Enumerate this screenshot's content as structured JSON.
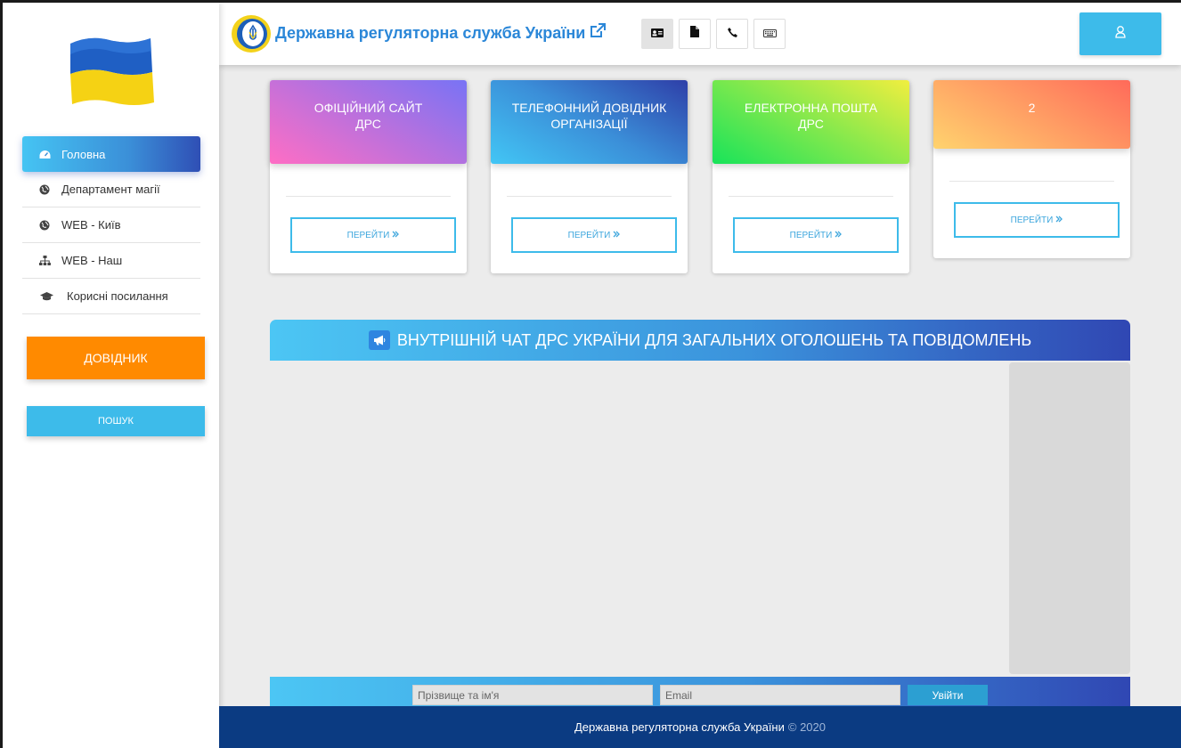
{
  "header": {
    "title": "Державна регуляторна служба України",
    "tool_buttons": [
      {
        "icon": "id-card-icon"
      },
      {
        "icon": "file-icon"
      },
      {
        "icon": "phone-icon"
      },
      {
        "icon": "keyboard-icon"
      }
    ],
    "user_icon": "user-icon"
  },
  "sidebar": {
    "items": [
      {
        "label": "Головна",
        "icon": "dashboard-icon",
        "active": true
      },
      {
        "label": "Департамент магії",
        "icon": "globe-icon"
      },
      {
        "label": "WEB - Київ",
        "icon": "globe-icon"
      },
      {
        "label": "WEB - Наш",
        "icon": "sitemap-icon"
      },
      {
        "label": "Корисні посилання",
        "icon": "graduation-cap-icon"
      }
    ],
    "dovidnyk_label": "ДОВІДНИК",
    "poshuk_label": "ПОШУК"
  },
  "cards": [
    {
      "title_line1": "ОФІЦІЙНИЙ САЙТ",
      "title_line2": "ДРС",
      "button": "ПЕРЕЙТИ",
      "gradient": [
        "#ff6ec4",
        "#7873f5"
      ]
    },
    {
      "title_line1": "ТЕЛЕФОННИЙ ДОВІДНИК",
      "title_line2": "ОРГАНІЗАЦІЇ",
      "button": "ПЕРЕЙТИ",
      "gradient": [
        "#42c6f5",
        "#2e3fa8"
      ]
    },
    {
      "title_line1": "ЕЛЕКТРОННА ПОШТА",
      "title_line2": "ДРС",
      "button": "ПЕРЕЙТИ",
      "gradient": [
        "#17e35a",
        "#f1ee3f"
      ]
    },
    {
      "title_line1": "2",
      "title_line2": "",
      "button": "ПЕРЕЙТИ",
      "gradient": [
        "#ffd36e",
        "#ff6a5a"
      ]
    }
  ],
  "chat": {
    "title": "ВНУТРІШНІЙ ЧАТ ДРС УКРАЇНИ ДЛЯ ЗАГАЛЬНИХ ОГОЛОШЕНЬ ТА ПОВІДОМЛЕНЬ",
    "name_placeholder": "Прізвище та ім'я",
    "email_placeholder": "Email",
    "login_label": "Увійти"
  },
  "footer": {
    "org": "Державна регуляторна служба України",
    "copyright": "© 2020"
  }
}
